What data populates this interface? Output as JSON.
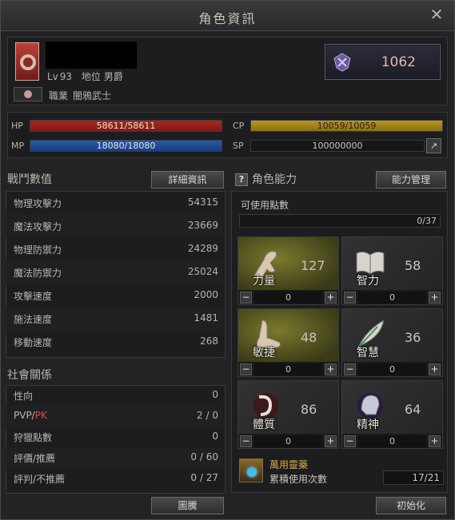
{
  "window": {
    "title": "角色資訊"
  },
  "profile": {
    "level_label": "Lv",
    "level": "93",
    "rank_label": "地位",
    "rank": "男爵",
    "class_label": "職業",
    "class_name": "闇鴉武士",
    "fame": "1062"
  },
  "bars": {
    "hp_label": "HP",
    "hp": "58611/58611",
    "mp_label": "MP",
    "mp": "18080/18080",
    "cp_label": "CP",
    "cp": "10059/10059",
    "sp_label": "SP",
    "sp": "100000000"
  },
  "combat": {
    "title": "戰鬥數值",
    "detail_button": "詳細資訊",
    "rows": [
      {
        "label": "物理攻擊力",
        "value": "54315"
      },
      {
        "label": "魔法攻擊力",
        "value": "23669"
      },
      {
        "label": "物理防禦力",
        "value": "24289"
      },
      {
        "label": "魔法防禦力",
        "value": "25024"
      },
      {
        "label": "攻擊速度",
        "value": "2000"
      },
      {
        "label": "施法速度",
        "value": "1481"
      },
      {
        "label": "移動速度",
        "value": "268"
      }
    ]
  },
  "social": {
    "title": "社會關係",
    "rows": [
      {
        "label": "性向",
        "value": "0"
      },
      {
        "label": "PVP/",
        "label_pk": "PK",
        "value": "2 / 0"
      },
      {
        "label": "狩獵點數",
        "value": "0"
      },
      {
        "label": "評價/推薦",
        "value": "0 / 60"
      },
      {
        "label": "評判/不推薦",
        "value": "0 / 27"
      }
    ],
    "button": "圖騰"
  },
  "abilities": {
    "help_icon": "?",
    "title": "角色能力",
    "manage_button": "能力管理",
    "points_label": "可使用點數",
    "points": "0/37",
    "stats": [
      {
        "name": "力量",
        "value": "127",
        "alloc": "0",
        "icon": "arm-icon",
        "highlight": true
      },
      {
        "name": "智力",
        "value": "58",
        "alloc": "0",
        "icon": "book-icon",
        "highlight": false
      },
      {
        "name": "敏捷",
        "value": "48",
        "alloc": "0",
        "icon": "foot-icon",
        "highlight": true
      },
      {
        "name": "智慧",
        "value": "36",
        "alloc": "0",
        "icon": "feather-icon",
        "highlight": false
      },
      {
        "name": "體質",
        "value": "86",
        "alloc": "0",
        "icon": "scroll-icon",
        "highlight": false
      },
      {
        "name": "精神",
        "value": "64",
        "alloc": "0",
        "icon": "spirit-head-icon",
        "highlight": false
      }
    ],
    "elixir_name": "萬用靈藥",
    "elixir_desc": "累積使用次數",
    "elixir_count": "17/21",
    "reset_button": "初始化"
  },
  "colors": {
    "hp": "#a42a22",
    "mp": "#2a5aa8",
    "cp": "#b8962a",
    "pk": "#e04848",
    "elixir": "#d8a84a"
  }
}
